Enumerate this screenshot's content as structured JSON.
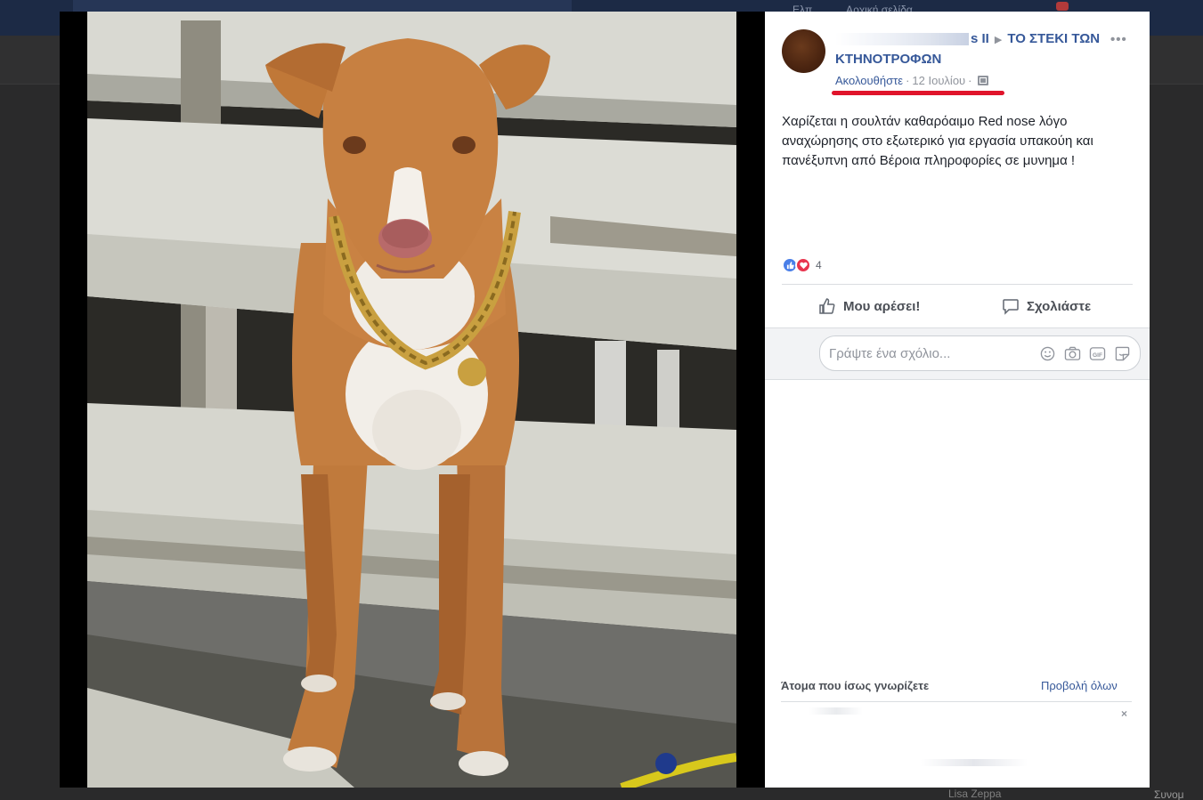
{
  "background": {
    "nav_items": [
      "Ελπ",
      "Αρχική σελίδα"
    ],
    "footer_left": "Lisa Zeppa",
    "footer_right": "Συνομ"
  },
  "post": {
    "page_name_fragment": "s II",
    "group_name": "ΤΟ ΣΤΕΚΙ ΤΩΝ ΚΤΗΝΟΤΡΟΦΩΝ",
    "follow_label": "Ακολουθήστε",
    "separator": "·",
    "date": "12 Ιουλίου",
    "more_label": "•••",
    "text": "Χαρίζεται η σουλτάν καθαρόαιμο Red nose λόγο αναχώρησης στο εξωτερικό για εργασία υπακούη και πανέξυπνη από Βέροια πληροφορίες σε μυνημα !",
    "reactions": {
      "types": [
        "like",
        "love"
      ],
      "count": "4"
    },
    "actions": {
      "like_label": "Μου αρέσει!",
      "comment_label": "Σχολιάστε"
    },
    "comment_box": {
      "placeholder": "Γράψτε ένα σχόλιο..."
    }
  },
  "people_you_may_know": {
    "title": "Άτομα που ίσως γνωρίζετε",
    "see_all": "Προβολή όλων",
    "close": "×"
  },
  "colors": {
    "link_blue": "#365899",
    "underline_red": "#e0142b",
    "like_blue": "#4a7fe8",
    "love_red": "#e8344e"
  }
}
